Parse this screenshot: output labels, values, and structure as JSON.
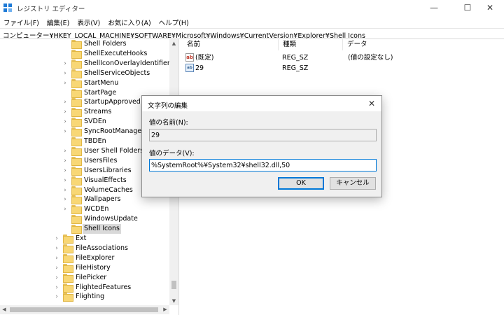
{
  "window": {
    "title": "レジストリ エディター",
    "minimize_glyph": "—",
    "maximize_glyph": "☐",
    "close_glyph": "✕",
    "icon": "registry-editor-icon"
  },
  "menu": [
    "ファイル(F)",
    "編集(E)",
    "表示(V)",
    "お気に入り(A)",
    "ヘルプ(H)"
  ],
  "address": "コンピューター¥HKEY_LOCAL_MACHINE¥SOFTWARE¥Microsoft¥Windows¥CurrentVersion¥Explorer¥Shell Icons",
  "tree": {
    "child_items": [
      {
        "label": "Shell Folders",
        "expandable": false
      },
      {
        "label": "ShellExecuteHooks",
        "expandable": false
      },
      {
        "label": "ShellIconOverlayIdentifiers",
        "expandable": true
      },
      {
        "label": "ShellServiceObjects",
        "expandable": true
      },
      {
        "label": "StartMenu",
        "expandable": true
      },
      {
        "label": "StartPage",
        "expandable": false
      },
      {
        "label": "StartupApproved",
        "expandable": true
      },
      {
        "label": "Streams",
        "expandable": true
      },
      {
        "label": "SVDEn",
        "expandable": true
      },
      {
        "label": "SyncRootManager",
        "expandable": true
      },
      {
        "label": "TBDEn",
        "expandable": false
      },
      {
        "label": "User Shell Folders",
        "expandable": true
      },
      {
        "label": "UsersFiles",
        "expandable": true
      },
      {
        "label": "UsersLibraries",
        "expandable": true
      },
      {
        "label": "VisualEffects",
        "expandable": true
      },
      {
        "label": "VolumeCaches",
        "expandable": true
      },
      {
        "label": "Wallpapers",
        "expandable": true
      },
      {
        "label": "WCDEn",
        "expandable": true
      },
      {
        "label": "WindowsUpdate",
        "expandable": false
      },
      {
        "label": "Shell Icons",
        "expandable": false,
        "selected": true
      }
    ],
    "parent_items": [
      {
        "label": "Ext",
        "expandable": true
      },
      {
        "label": "FileAssociations",
        "expandable": true
      },
      {
        "label": "FileExplorer",
        "expandable": true
      },
      {
        "label": "FileHistory",
        "expandable": true
      },
      {
        "label": "FilePicker",
        "expandable": true
      },
      {
        "label": "FlightedFeatures",
        "expandable": true
      },
      {
        "label": "Flighting",
        "expandable": true
      }
    ]
  },
  "values_pane": {
    "columns": [
      "名前",
      "種類",
      "データ"
    ],
    "rows": [
      {
        "name": "(既定)",
        "type": "REG_SZ",
        "data": "(値の設定なし)",
        "icon": "ab-icon",
        "icon_text": "ab"
      },
      {
        "name": "29",
        "type": "REG_SZ",
        "data": "",
        "icon": "binary-value-icon",
        "icon_text": "ab"
      }
    ]
  },
  "dialog": {
    "title": "文字列の編集",
    "name_label": "値の名前(N):",
    "name_value": "29",
    "data_label": "値のデータ(V):",
    "data_value": "%SystemRoot%¥System32¥shell32.dll,50",
    "ok_label": "OK",
    "cancel_label": "キャンセル",
    "close_glyph": "✕"
  }
}
